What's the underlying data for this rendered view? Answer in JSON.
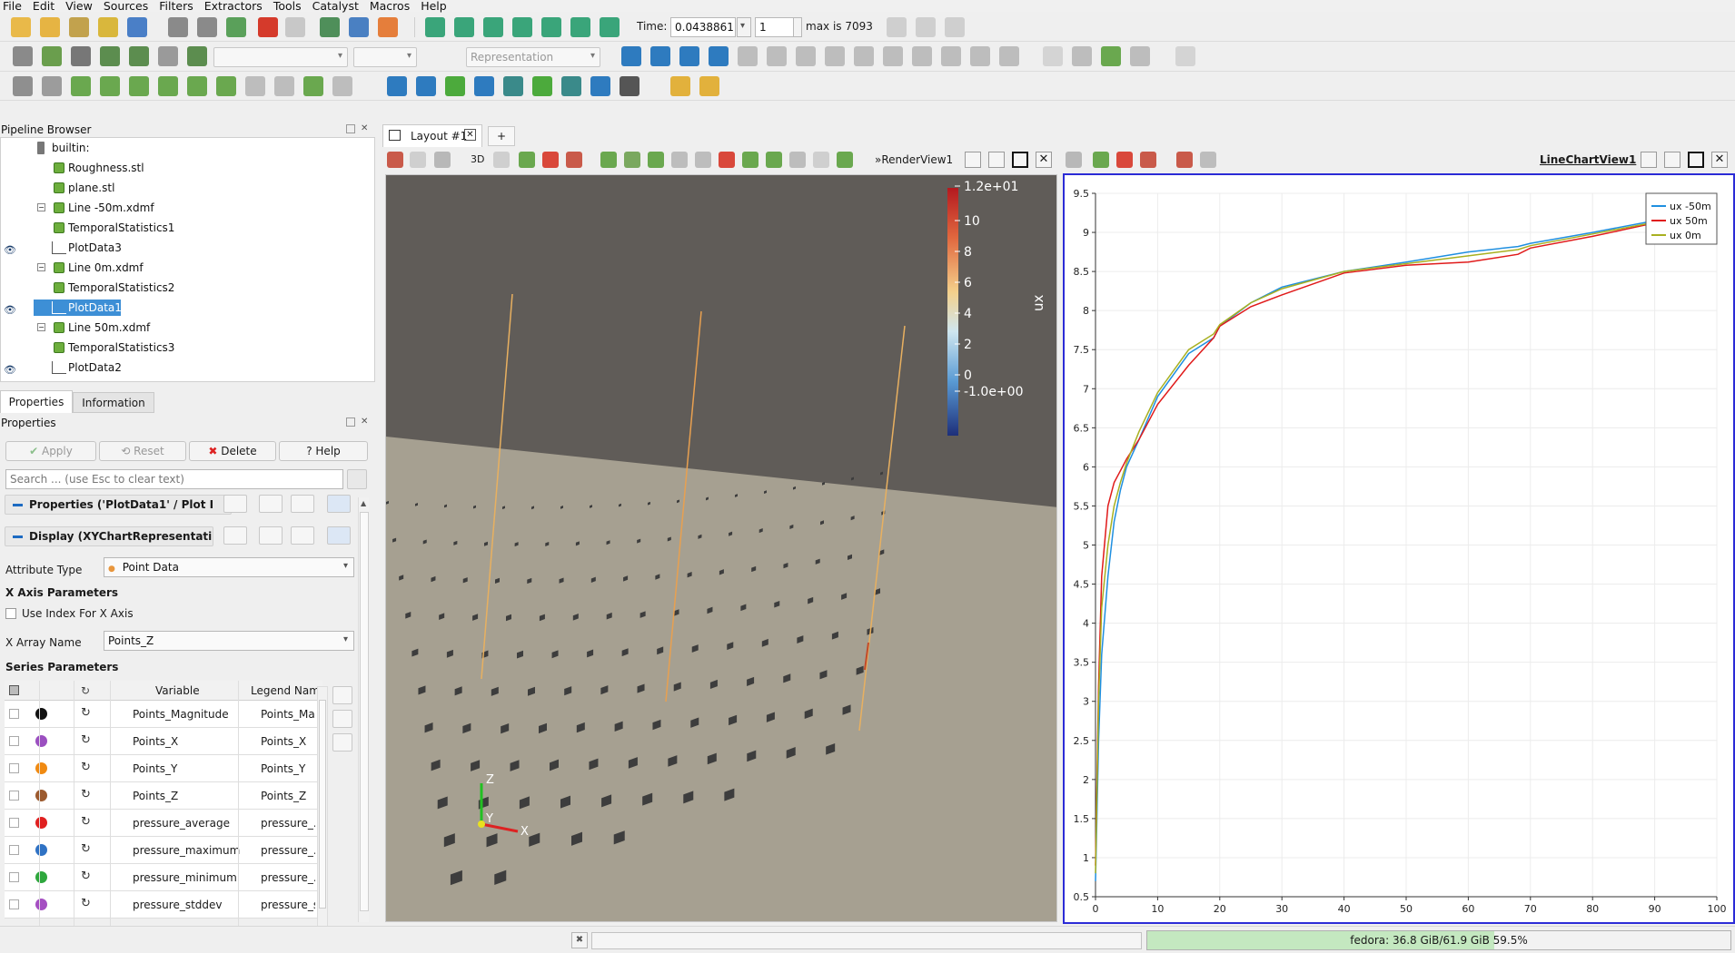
{
  "menu": [
    "File",
    "Edit",
    "View",
    "Sources",
    "Filters",
    "Extractors",
    "Tools",
    "Catalyst",
    "Macros",
    "Help"
  ],
  "time": {
    "label": "Time:",
    "value": "0.0438861",
    "step": "1",
    "max_label": "max is 7093"
  },
  "toolbar2": {
    "representation_placeholder": "Representation"
  },
  "pipeline": {
    "title": "Pipeline Browser",
    "items": [
      {
        "label": "builtin:",
        "visible": false
      },
      {
        "label": "Roughness.stl",
        "visible": false
      },
      {
        "label": "plane.stl",
        "visible": false
      },
      {
        "label": "Line -50m.xdmf",
        "visible": false
      },
      {
        "label": "TemporalStatistics1",
        "visible": false
      },
      {
        "label": "PlotData3",
        "visible": true
      },
      {
        "label": "Line 0m.xdmf",
        "visible": false
      },
      {
        "label": "TemporalStatistics2",
        "visible": false
      },
      {
        "label": "PlotData1",
        "visible": true,
        "selected": true
      },
      {
        "label": "Line 50m.xdmf",
        "visible": false
      },
      {
        "label": "TemporalStatistics3",
        "visible": false
      },
      {
        "label": "PlotData2",
        "visible": true
      }
    ]
  },
  "tabs": {
    "properties": "Properties",
    "information": "Information"
  },
  "props": {
    "title": "Properties",
    "apply": "Apply",
    "reset": "Reset",
    "delete": "Delete",
    "help": "Help",
    "search_placeholder": "Search ... (use Esc to clear text)",
    "section1": "Properties ('PlotData1' / Plot I",
    "section2": "Display (XYChartRepresentati",
    "attribute_type_label": "Attribute Type",
    "attribute_type_value": "Point Data",
    "x_axis_params": "X Axis Parameters",
    "use_index_label": "Use Index For X Axis",
    "x_array_label": "X Array Name",
    "x_array_value": "Points_Z",
    "series_params": "Series Parameters",
    "col_variable": "Variable",
    "col_legend": "Legend Name",
    "series": [
      {
        "var": "Points_Magnitude",
        "legend": "Points_Ma...",
        "color": "#111111"
      },
      {
        "var": "Points_X",
        "legend": "Points_X",
        "color": "#9b4fc0"
      },
      {
        "var": "Points_Y",
        "legend": "Points_Y",
        "color": "#f08a12"
      },
      {
        "var": "Points_Z",
        "legend": "Points_Z",
        "color": "#9c5a2e"
      },
      {
        "var": "pressure_average",
        "legend": "pressure_...",
        "color": "#e02020"
      },
      {
        "var": "pressure_maximum",
        "legend": "pressure_...",
        "color": "#2f72c4"
      },
      {
        "var": "pressure_minimum",
        "legend": "pressure_...",
        "color": "#2ea73d"
      },
      {
        "var": "pressure_stddev",
        "legend": "pressure_s",
        "color": "#a54fc2"
      }
    ]
  },
  "layout": {
    "tab": "Layout #1",
    "add": "+"
  },
  "render_view": {
    "name": "RenderView1",
    "mode_3d": "3D",
    "colorbar": {
      "title": "ux",
      "ticks": [
        "1.2e+01",
        "10",
        "8",
        "6",
        "4",
        "2",
        "0",
        "-1.0e+00"
      ]
    },
    "axes": {
      "x": "X",
      "y": "Y",
      "z": "Z"
    }
  },
  "chart_view": {
    "name": "LineChartView1"
  },
  "chart_data": {
    "type": "line",
    "x_ticks": [
      "0",
      "10",
      "20",
      "30",
      "40",
      "50",
      "60",
      "70",
      "80",
      "90",
      "100"
    ],
    "y_ticks": [
      "0.5",
      "1",
      "1.5",
      "2",
      "2.5",
      "3",
      "3.5",
      "4",
      "4.5",
      "5",
      "5.5",
      "6",
      "6.5",
      "7",
      "7.5",
      "8",
      "8.5",
      "9",
      "9.5"
    ],
    "xlim": [
      0,
      100
    ],
    "ylim": [
      0.5,
      9.5
    ],
    "legend_position": "top-right",
    "series": [
      {
        "name": "ux -50m",
        "color": "#1f8fe0",
        "x": [
          0,
          0.5,
          1,
          2,
          3,
          4,
          5,
          7,
          10,
          15,
          19,
          20,
          25,
          30,
          40,
          50,
          60,
          68,
          70,
          80,
          90,
          95
        ],
        "y": [
          0.7,
          2.5,
          3.6,
          4.6,
          5.3,
          5.7,
          6.0,
          6.35,
          6.9,
          7.45,
          7.65,
          7.8,
          8.1,
          8.3,
          8.5,
          8.62,
          8.75,
          8.82,
          8.86,
          9.0,
          9.15,
          9.2
        ]
      },
      {
        "name": "ux 50m",
        "color": "#e01a1a",
        "x": [
          0,
          0.5,
          1,
          2,
          3,
          4,
          5,
          7,
          10,
          15,
          19,
          20,
          25,
          30,
          40,
          50,
          60,
          68,
          70,
          80,
          90,
          95
        ],
        "y": [
          0.9,
          3.2,
          4.6,
          5.5,
          5.8,
          5.95,
          6.1,
          6.35,
          6.8,
          7.3,
          7.65,
          7.8,
          8.05,
          8.2,
          8.48,
          8.58,
          8.62,
          8.72,
          8.8,
          8.95,
          9.12,
          9.2
        ]
      },
      {
        "name": "ux 0m",
        "color": "#a8b020",
        "x": [
          0,
          0.5,
          1,
          2,
          3,
          4,
          5,
          7,
          10,
          15,
          19,
          20,
          25,
          30,
          40,
          50,
          60,
          68,
          70,
          80,
          90,
          95
        ],
        "y": [
          0.8,
          3.0,
          4.2,
          5.0,
          5.5,
          5.8,
          6.05,
          6.45,
          6.95,
          7.5,
          7.7,
          7.82,
          8.1,
          8.28,
          8.5,
          8.6,
          8.7,
          8.78,
          8.83,
          8.98,
          9.13,
          9.2
        ]
      }
    ]
  },
  "status": {
    "memory": "fedora: 36.8 GiB/61.9 GiB 59.5%",
    "memory_fraction": 0.595
  }
}
